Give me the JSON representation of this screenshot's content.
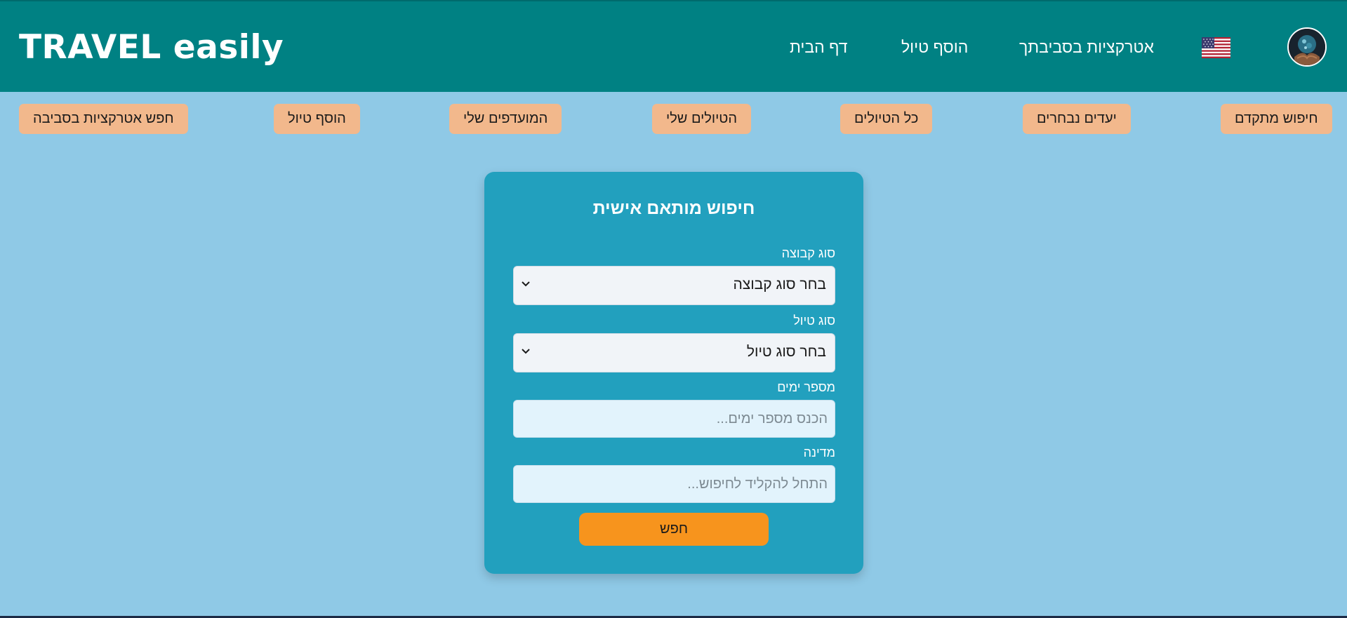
{
  "header": {
    "brand": "TRAVEL easily",
    "nav": [
      "דף הבית",
      "הוסף טיול",
      "אטרקציות בסביבתך"
    ],
    "language_flag": "us-flag-icon",
    "avatar": "user-avatar"
  },
  "toolbar": {
    "buttons": [
      "חפש אטרקציות בסביבה",
      "הוסף טיול",
      "המועדפים שלי",
      "הטיולים שלי",
      "כל הטיולים",
      "יעדים נבחרים",
      "חיפוש מתקדם"
    ]
  },
  "search_form": {
    "title": "חיפוש מותאם אישית",
    "group_type": {
      "label": "סוג קבוצה",
      "value": "בחר סוג קבוצה"
    },
    "trip_type": {
      "label": "סוג טיול",
      "value": "בחר סוג טיול"
    },
    "days": {
      "label": "מספר ימים",
      "placeholder": "הכנס מספר ימים..."
    },
    "country": {
      "label": "מדינה",
      "placeholder": "התחל להקליד לחיפוש..."
    },
    "submit_label": "חפש"
  },
  "colors": {
    "header_bg": "#008183",
    "page_bg": "#8fc9e6",
    "card_bg": "#22a0be",
    "pill_bg": "#f2b88c",
    "accent_button": "#f7941d"
  }
}
